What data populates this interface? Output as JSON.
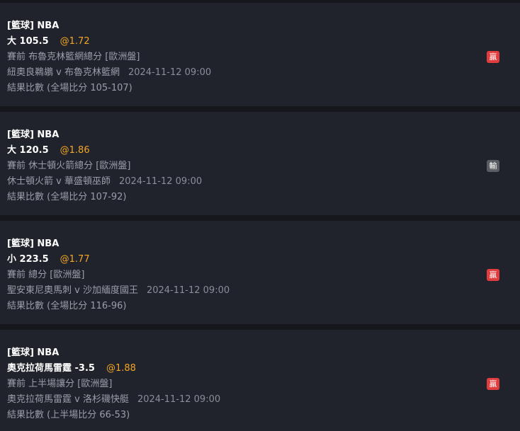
{
  "bets": [
    {
      "category": "[籃球] NBA",
      "selection": "大 105.5",
      "odds": "@1.72",
      "market": "賽前 布魯克林籃網總分 [歐洲盤]",
      "match": "紐奧良鵜鶘 v 布魯克林籃網",
      "time": "2024-11-12 09:00",
      "result": "結果比數 (全場比分 105-107)",
      "status": "贏",
      "status_color": "#e03e3e"
    },
    {
      "category": "[籃球] NBA",
      "selection": "大 120.5",
      "odds": "@1.86",
      "market": "賽前 休士頓火箭總分 [歐洲盤]",
      "match": "休士頓火箭 v 華盛頓巫師",
      "time": "2024-11-12 09:00",
      "result": "結果比數 (全場比分 107-92)",
      "status": "輸",
      "status_color": "#5a5d63"
    },
    {
      "category": "[籃球] NBA",
      "selection": "小 223.5",
      "odds": "@1.77",
      "market": "賽前 總分 [歐洲盤]",
      "match": "聖安東尼奧馬刺 v 沙加緬度國王",
      "time": "2024-11-12 09:00",
      "result": "結果比數 (全場比分 116-96)",
      "status": "贏",
      "status_color": "#e03e3e"
    },
    {
      "category": "[籃球] NBA",
      "selection": "奧克拉荷馬雷霆 -3.5",
      "odds": "@1.88",
      "market": "賽前 上半場讓分 [歐洲盤]",
      "match": "奧克拉荷馬雷霆 v 洛杉磯快艇",
      "time": "2024-11-12 09:00",
      "result": "結果比數 (上半場比分 66-53)",
      "status": "贏",
      "status_color": "#e03e3e"
    }
  ]
}
